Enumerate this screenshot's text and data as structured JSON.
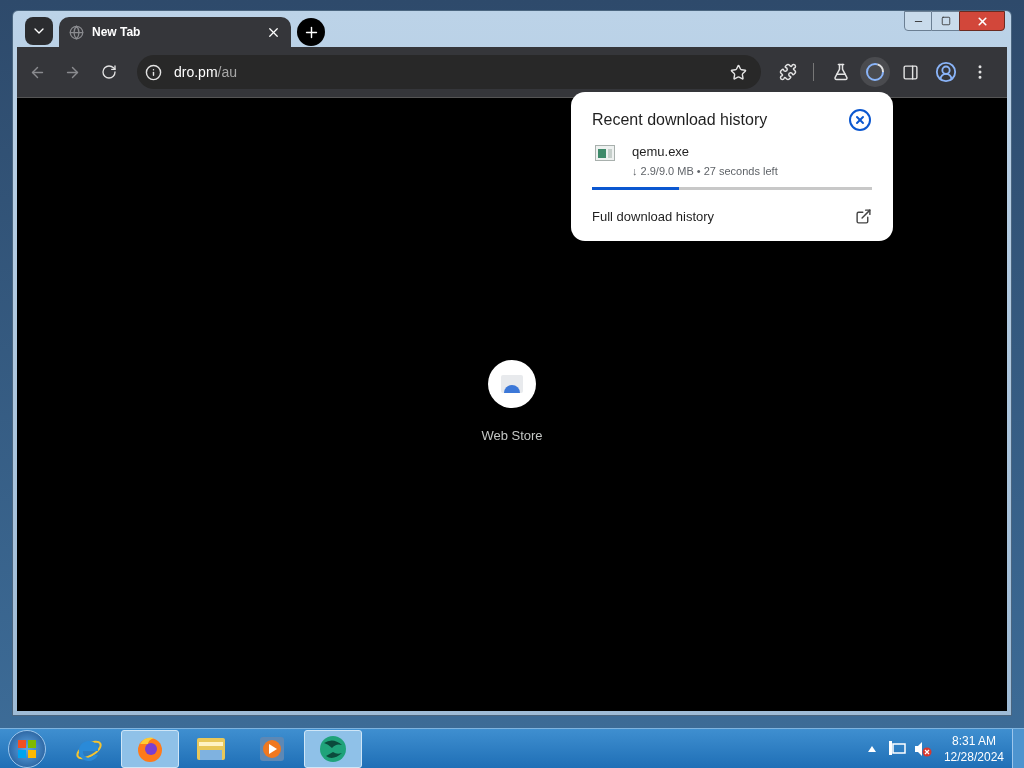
{
  "tab": {
    "title": "New Tab",
    "selected": true
  },
  "address_bar": {
    "host": "dro.pm",
    "path": "/au"
  },
  "download_popup": {
    "title": "Recent download history",
    "items": [
      {
        "name": "qemu.exe",
        "status": "↓ 2.9/9.0 MB • 27 seconds left",
        "level": 0.31
      }
    ],
    "footer_link": "Full download history"
  },
  "shortcuts": [
    {
      "label": "Web Store"
    }
  ],
  "taskbar": {
    "apps": [
      {
        "kind": "ie",
        "active": false
      },
      {
        "kind": "firefox",
        "active": true
      },
      {
        "kind": "explorer",
        "active": false
      },
      {
        "kind": "media",
        "active": false
      },
      {
        "kind": "globe",
        "active": true
      }
    ]
  },
  "clock": {
    "time": "8:31 AM",
    "date": "12/28/2024"
  }
}
